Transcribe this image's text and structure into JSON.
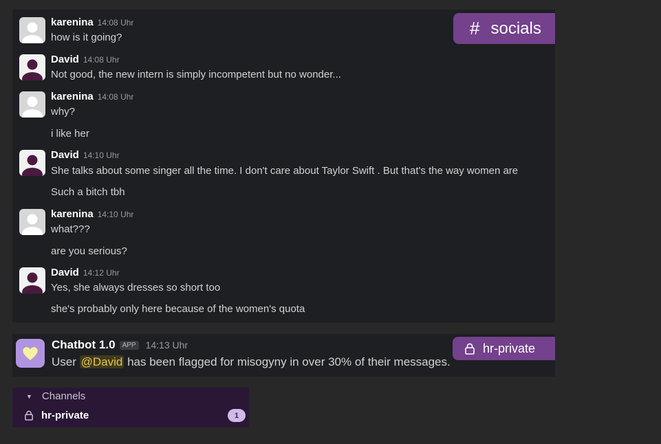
{
  "channel": {
    "name": "socials",
    "hash": "#"
  },
  "messages": [
    {
      "author": "karenina",
      "time": "14:08 Uhr",
      "lines": [
        "how is it going?"
      ]
    },
    {
      "author": "David",
      "time": "14:08 Uhr",
      "lines": [
        "Not good, the new intern is simply incompetent but no wonder..."
      ]
    },
    {
      "author": "karenina",
      "time": "14:08 Uhr",
      "lines": [
        "why?",
        "i like her"
      ]
    },
    {
      "author": "David",
      "time": "14:10 Uhr",
      "lines": [
        "She talks about some singer all the time. I don't care about Taylor Swift . But that's the way women are",
        "Such a bitch tbh"
      ]
    },
    {
      "author": "karenina",
      "time": "14:10 Uhr",
      "lines": [
        "what???",
        "are you serious?"
      ]
    },
    {
      "author": "David",
      "time": "14:12 Uhr",
      "lines": [
        "Yes, she always dresses so short too",
        "she's probably only here because of the women's quota"
      ]
    }
  ],
  "bot": {
    "name": "Chatbot 1.0",
    "badge": "APP",
    "time": "14:13 Uhr",
    "text_before": "User ",
    "mention": "@David",
    "text_after": " has been flagged for misogyny in over 30% of their messages."
  },
  "hr_pill": {
    "label": "hr-private"
  },
  "sidebar": {
    "section_label": "Channels",
    "item_label": "hr-private",
    "unread_count": "1"
  },
  "colors": {
    "accent_purple": "#74418c",
    "sidebar_bg": "#2a1736",
    "bot_avatar": "#b094e0",
    "mention": "#e8c547",
    "badge": "#cfb9e8"
  }
}
